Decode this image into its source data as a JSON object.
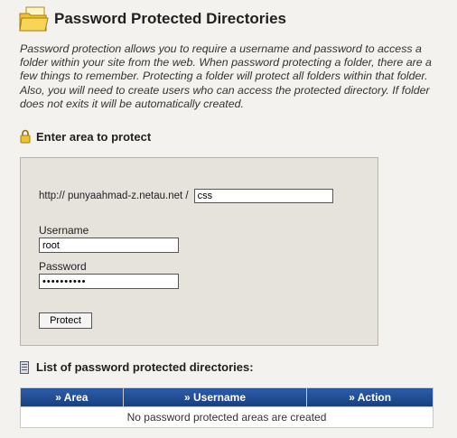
{
  "header": {
    "title": "Password Protected Directories",
    "icon": "folder-icon"
  },
  "intro": "Password protection allows you to require a username and password to access a folder within your site from the web. When password protecting a folder, there are a few things to remember. Protecting a folder will protect all folders within that folder. Also, you will need to create users who can access the protected directory. If folder does not exits it will be automatically created.",
  "protect_section": {
    "heading": "Enter area to protect",
    "icon": "lock-icon",
    "url_prefix": "http:// punyaahmad-z.netau.net /",
    "directory_value": "css",
    "username_label": "Username",
    "username_value": "root",
    "password_label": "Password",
    "password_value": "••••••••••",
    "protect_button": "Protect"
  },
  "list_section": {
    "heading": "List of password protected directories:",
    "icon": "document-icon",
    "columns": [
      "» Area",
      "» Username",
      "» Action"
    ],
    "empty_message": "No password protected areas are created"
  },
  "colors": {
    "background": "#f3f2ee",
    "panel": "#e6e3dd",
    "table_header": "#1d4a92"
  }
}
